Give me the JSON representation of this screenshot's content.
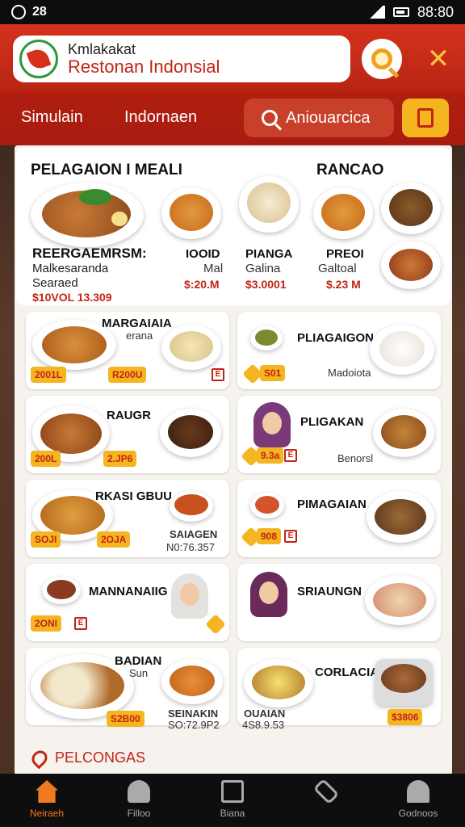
{
  "status_bar": {
    "left_text": "28",
    "time": "88:80"
  },
  "header": {
    "brand_sub": "Kmlakakat",
    "brand_main": "Restonan Indonsial"
  },
  "navbar": {
    "tabs": [
      {
        "label": "Simulain"
      },
      {
        "label": "Indornaen"
      }
    ],
    "search_label": "Aniouarcica"
  },
  "hero": {
    "title": "PELAGAION I MEALI",
    "right_title": "RANCAO",
    "sub_title": "REERGAEMRSM:",
    "line1": "Malkesaranda",
    "line2": "Searaed",
    "price_left": "$10VOL 13.309",
    "items": [
      {
        "name": "IOOID",
        "meta": "Mal",
        "price": "$:20.M"
      },
      {
        "name": "PIANGA",
        "meta": "Galina",
        "price": "$3.0001"
      },
      {
        "name": "PREOI",
        "meta": "Galtoal",
        "price": "$.23 M"
      }
    ]
  },
  "cards": [
    {
      "title": "MARGAIAIA",
      "sub": "erana",
      "tags": [
        "2001L",
        "R200U"
      ],
      "badge": "E"
    },
    {
      "title": "PLIAGAIGON",
      "sub": "Madoiota",
      "tags": [
        "S01"
      ],
      "badge": ""
    },
    {
      "title": "RAUGR",
      "sub": "",
      "tags": [
        "200L",
        "2.JP6"
      ],
      "badge": ""
    },
    {
      "title": "PLIGAKAN",
      "sub": "Benorsl",
      "tags": [
        "9.3a"
      ],
      "badge": "E"
    },
    {
      "title": "RKASI GBUU",
      "sub": "",
      "tags": [
        "SOJI",
        "2OJA"
      ],
      "badge": ""
    },
    {
      "title": "PIMAGAIAN",
      "sub": "",
      "tags": [
        "908"
      ],
      "badge": "E"
    },
    {
      "title": "MANNANAIIG",
      "sub": "",
      "tags": [
        "2ONI"
      ],
      "badge": "E"
    },
    {
      "title": "SRIAUNGN",
      "sub": "",
      "tags": [],
      "badge": ""
    },
    {
      "title": "BADIAN",
      "sub": "Sun",
      "tags": [
        "S2B00"
      ],
      "badge": ""
    },
    {
      "title": "CORLACIAR",
      "sub": "",
      "tags": [
        "$3806"
      ],
      "badge": ""
    }
  ],
  "card_extra": {
    "c5_name": "SAIAGEN",
    "c5_price": "N0:76.357",
    "c9_name": "SEINAKIN",
    "c9_price": "SO:72.9P2",
    "c10_name": "OUAIAN",
    "c10_price": "4S8.9.53"
  },
  "footer_link": "PELCONGAS",
  "bottom_nav": [
    {
      "label": "Neiraeh",
      "active": true
    },
    {
      "label": "Filloo",
      "active": false
    },
    {
      "label": "Biana",
      "active": false
    },
    {
      "label": "",
      "active": false
    },
    {
      "label": "Godnoos",
      "active": false
    }
  ],
  "colors": {
    "primary_red": "#c22414",
    "accent_yellow": "#f5b520",
    "active_orange": "#f07a20"
  }
}
